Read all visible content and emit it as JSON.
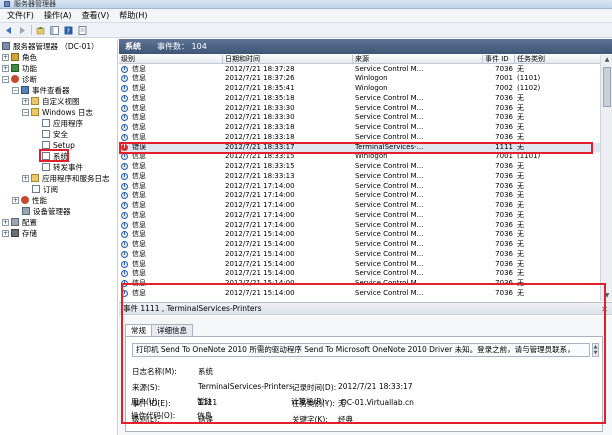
{
  "window": {
    "title": "服务器管理器"
  },
  "menu": [
    "文件(F)",
    "操作(A)",
    "查看(V)",
    "帮助(H)"
  ],
  "toolbar": [
    "back-icon",
    "forward-icon",
    "up-icon",
    "show-hide-icon",
    "help-icon",
    "properties-icon"
  ],
  "tree": {
    "root": "服务器管理器 （DC-01）",
    "roles": "角色",
    "features": "功能",
    "diagnostics": "诊断",
    "event_viewer": "事件查看器",
    "custom_views": "自定义视图",
    "windows_logs": "Windows 日志",
    "application": "应用程序",
    "security": "安全",
    "setup": "Setup",
    "system": "系统",
    "forwarded": "转发事件",
    "apps_services": "应用程序和服务日志",
    "subscriptions": "订阅",
    "performance": "性能",
    "device_manager": "设备管理器",
    "configuration": "配置",
    "storage": "存储"
  },
  "main": {
    "header_title": "系统",
    "event_count": "事件数： 104",
    "columns": [
      "级别",
      "日期和时间",
      "来源",
      "事件 ID",
      "任务类别"
    ],
    "rows": [
      {
        "level": "信息",
        "date": "2012/7/21 18:37:28",
        "source": "Service Control M...",
        "id": "7036",
        "task": "无",
        "type": "info"
      },
      {
        "level": "信息",
        "date": "2012/7/21 18:37:26",
        "source": "Winlogon",
        "id": "7001",
        "task": "(1101)",
        "type": "info"
      },
      {
        "level": "信息",
        "date": "2012/7/21 18:35:41",
        "source": "Winlogon",
        "id": "7002",
        "task": "(1102)",
        "type": "info"
      },
      {
        "level": "信息",
        "date": "2012/7/21 18:35:18",
        "source": "Service Control M...",
        "id": "7036",
        "task": "无",
        "type": "info"
      },
      {
        "level": "信息",
        "date": "2012/7/21 18:33:30",
        "source": "Service Control M...",
        "id": "7036",
        "task": "无",
        "type": "info"
      },
      {
        "level": "信息",
        "date": "2012/7/21 18:33:30",
        "source": "Service Control M...",
        "id": "7036",
        "task": "无",
        "type": "info"
      },
      {
        "level": "信息",
        "date": "2012/7/21 18:33:18",
        "source": "Service Control M...",
        "id": "7036",
        "task": "无",
        "type": "info"
      },
      {
        "level": "信息",
        "date": "2012/7/21 18:33:18",
        "source": "Service Control M...",
        "id": "7036",
        "task": "无",
        "type": "info"
      },
      {
        "level": "错误",
        "date": "2012/7/21 18:33:17",
        "source": "TerminalServices-...",
        "id": "1111",
        "task": "无",
        "type": "error"
      },
      {
        "level": "信息",
        "date": "2012/7/21 18:33:15",
        "source": "Winlogon",
        "id": "7001",
        "task": "(1101)",
        "type": "info"
      },
      {
        "level": "信息",
        "date": "2012/7/21 18:33:15",
        "source": "Service Control M...",
        "id": "7036",
        "task": "无",
        "type": "info"
      },
      {
        "level": "信息",
        "date": "2012/7/21 18:33:13",
        "source": "Service Control M...",
        "id": "7036",
        "task": "无",
        "type": "info"
      },
      {
        "level": "信息",
        "date": "2012/7/21 17:14:00",
        "source": "Service Control M...",
        "id": "7036",
        "task": "无",
        "type": "info"
      },
      {
        "level": "信息",
        "date": "2012/7/21 17:14:00",
        "source": "Service Control M...",
        "id": "7036",
        "task": "无",
        "type": "info"
      },
      {
        "level": "信息",
        "date": "2012/7/21 17:14:00",
        "source": "Service Control M...",
        "id": "7036",
        "task": "无",
        "type": "info"
      },
      {
        "level": "信息",
        "date": "2012/7/21 17:14:00",
        "source": "Service Control M...",
        "id": "7036",
        "task": "无",
        "type": "info"
      },
      {
        "level": "信息",
        "date": "2012/7/21 17:14:00",
        "source": "Service Control M...",
        "id": "7036",
        "task": "无",
        "type": "info"
      },
      {
        "level": "信息",
        "date": "2012/7/21 15:14:00",
        "source": "Service Control M...",
        "id": "7036",
        "task": "无",
        "type": "info"
      },
      {
        "level": "信息",
        "date": "2012/7/21 15:14:00",
        "source": "Service Control M...",
        "id": "7036",
        "task": "无",
        "type": "info"
      },
      {
        "level": "信息",
        "date": "2012/7/21 15:14:00",
        "source": "Service Control M...",
        "id": "7036",
        "task": "无",
        "type": "info"
      },
      {
        "level": "信息",
        "date": "2012/7/21 15:14:00",
        "source": "Service Control M...",
        "id": "7036",
        "task": "无",
        "type": "info"
      },
      {
        "level": "信息",
        "date": "2012/7/21 15:14:00",
        "source": "Service Control M...",
        "id": "7036",
        "task": "无",
        "type": "info"
      },
      {
        "level": "信息",
        "date": "2012/7/21 15:14:00",
        "source": "Service Control M...",
        "id": "7036",
        "task": "无",
        "type": "info"
      },
      {
        "level": "信息",
        "date": "2012/7/21 15:14:00",
        "source": "Service Control M...",
        "id": "7036",
        "task": "无",
        "type": "info"
      }
    ]
  },
  "detail": {
    "header": "事件 1111 , TerminalServices-Printers",
    "tabs": [
      "常规",
      "详细信息"
    ],
    "message": "打印机 Send To OneNote 2010 所需的驱动程序 Send To Microsoft OneNote 2010 Driver 未知。登录之前，请与管理员联系，",
    "fields": {
      "log_name_label": "日志名称(M):",
      "log_name": "系统",
      "source_label": "来源(S):",
      "source": "TerminalServices-Printers",
      "logged_label": "记录时间(D):",
      "logged": "2012/7/21 18:33:17",
      "event_id_label": "事件 ID(E):",
      "event_id": "1111",
      "task_label": "任务类别(Y):",
      "task": "无",
      "level_label": "级别(L):",
      "level": "错误",
      "keywords_label": "关键字(K):",
      "keywords": "经典",
      "user_label": "用户(U):",
      "user": "暂缺",
      "computer_label": "计算机(R):",
      "computer": "DC-01.Virtuallab.cn",
      "opcode_label": "操作代码(O):",
      "opcode": "信息"
    }
  }
}
